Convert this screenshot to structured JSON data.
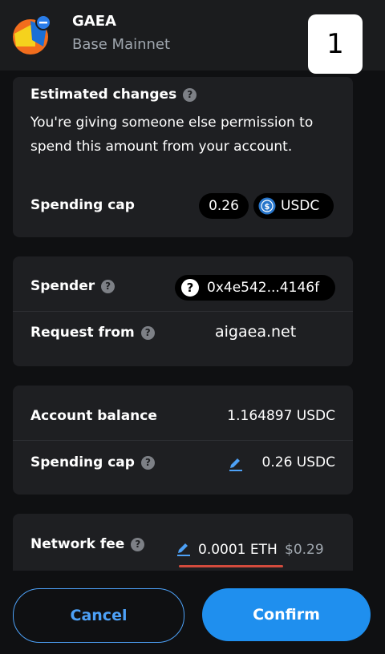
{
  "header": {
    "app_name": "GAEA",
    "network": "Base Mainnet",
    "step": "1"
  },
  "estimated": {
    "title": "Estimated changes",
    "description": "You're giving someone else permission to spend this amount from your account.",
    "spending_cap_label": "Spending cap",
    "amount": "0.26",
    "token": "USDC"
  },
  "spender": {
    "label": "Spender",
    "address": "0x4e542...4146f",
    "request_label": "Request from",
    "request_value": "aigaea.net"
  },
  "balance": {
    "label": "Account balance",
    "value": "1.164897 USDC",
    "cap_label": "Spending cap",
    "cap_value": "0.26 USDC"
  },
  "fee": {
    "label": "Network fee",
    "eth": "0.0001 ETH",
    "usd": "$0.29"
  },
  "buttons": {
    "cancel": "Cancel",
    "confirm": "Confirm"
  },
  "colors": {
    "accent": "#1f8fee",
    "link": "#4da1f7",
    "underline": "#d34b3d"
  }
}
